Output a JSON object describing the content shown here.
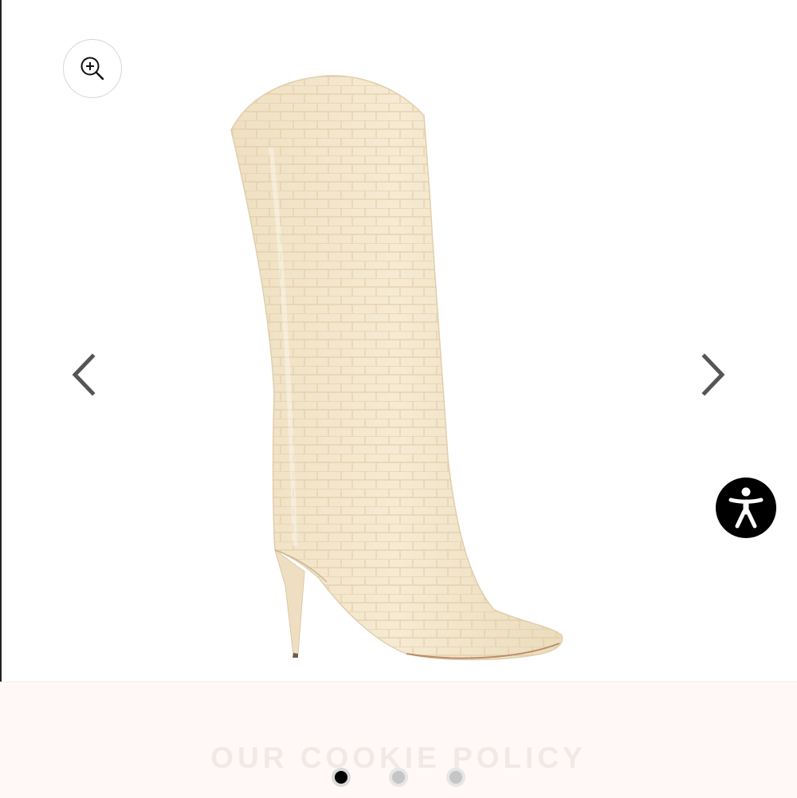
{
  "gallery": {
    "product_image_alt": "Cream croc-embossed knee-high stiletto boot",
    "zoom_icon": "zoom-in-icon",
    "prev_icon": "chevron-left-icon",
    "next_icon": "chevron-right-icon",
    "active_slide": 1,
    "slide_count": 3
  },
  "accessibility": {
    "icon": "accessibility-person-icon",
    "button_color": "#000000"
  },
  "cookie_banner": {
    "title": "OUR COOKIE POLICY"
  },
  "colors": {
    "boot": "#f1e4c9",
    "boot_shadow": "#e3d0ac",
    "arrow": "#555555",
    "dot_active": "#000000",
    "dot_inactive": "#c5c5c5"
  }
}
